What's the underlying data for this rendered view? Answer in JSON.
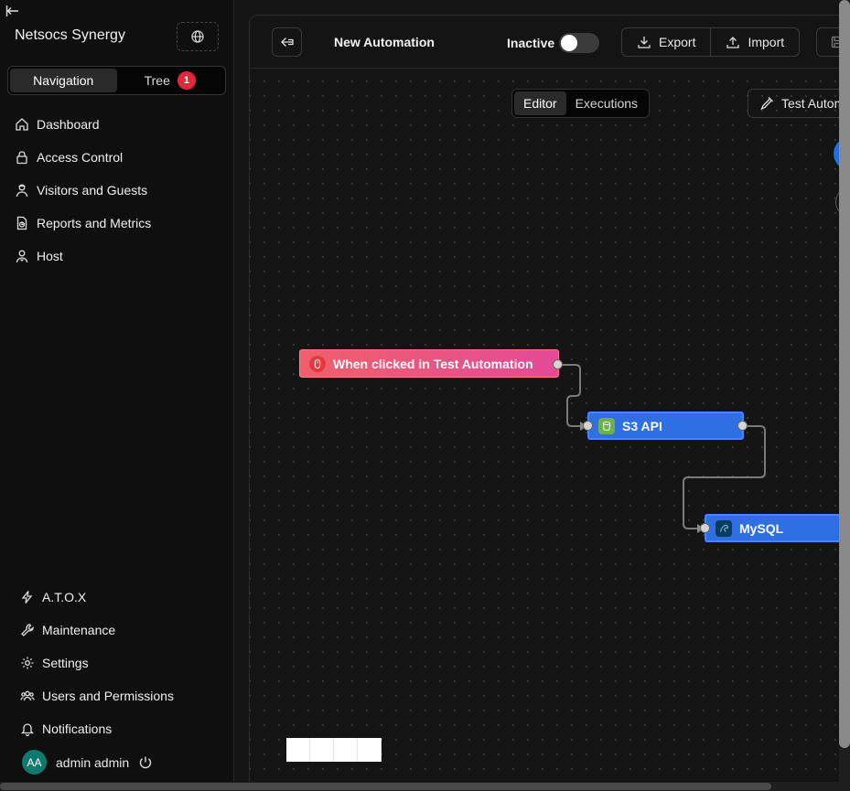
{
  "sidebar": {
    "title": "Netsocs Synergy",
    "segments": [
      {
        "label": "Navigation",
        "active": true
      },
      {
        "label": "Tree",
        "badge": "1"
      }
    ],
    "items": [
      {
        "label": "Dashboard",
        "icon": "home-icon"
      },
      {
        "label": "Access Control",
        "icon": "lock-icon"
      },
      {
        "label": "Visitors and Guests",
        "icon": "visitor-icon"
      },
      {
        "label": "Reports and Metrics",
        "icon": "report-icon"
      },
      {
        "label": "Host",
        "icon": "host-icon"
      }
    ],
    "bottom_items": [
      {
        "label": "A.T.O.X",
        "icon": "atox-icon"
      },
      {
        "label": "Maintenance",
        "icon": "wrench-icon"
      },
      {
        "label": "Settings",
        "icon": "gear-icon"
      },
      {
        "label": "Users and Permissions",
        "icon": "users-icon"
      },
      {
        "label": "Notifications",
        "icon": "bell-icon"
      }
    ],
    "user": {
      "initials": "AA",
      "name": "admin admin"
    }
  },
  "toolbar": {
    "title": "New Automation",
    "status": "Inactive",
    "export_label": "Export",
    "import_label": "Import"
  },
  "canvas": {
    "tabs": [
      {
        "label": "Editor",
        "active": true
      },
      {
        "label": "Executions"
      }
    ],
    "test_button": "Test Automation",
    "nodes": {
      "trigger": "When clicked in Test Automation",
      "s3": "S3 API",
      "mysql": "MySQL"
    }
  },
  "colors": {
    "accent": "#2f6fe4",
    "badge": "#e5263a",
    "trigger_start": "#f0606a",
    "trigger_end": "#e44a98",
    "avatar": "#0e7a6d"
  }
}
